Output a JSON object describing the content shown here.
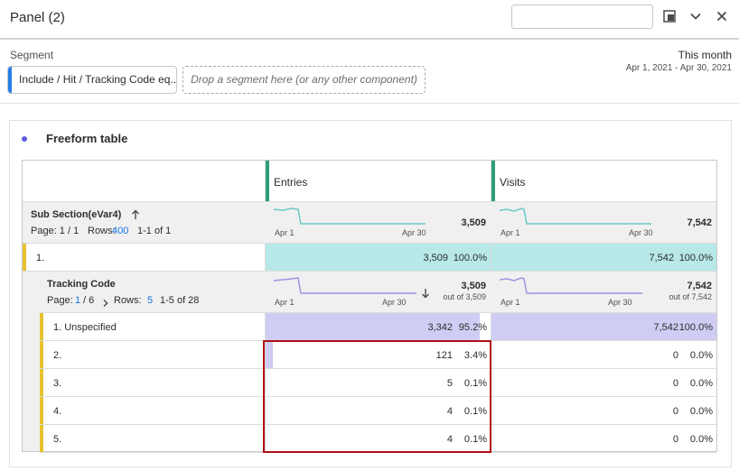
{
  "panel": {
    "title": "Panel (2)",
    "search_value": ""
  },
  "icons": {
    "collapse": "panel-toggle-icon",
    "chevron": "chevron-down-icon",
    "close": "close-icon",
    "sort": "sort-arrow-icon",
    "pager": "chevron-right-icon"
  },
  "segment": {
    "label": "Segment",
    "applied": "Include / Hit / Tracking Code eq...",
    "drop_placeholder": "Drop a segment here (or any other component)"
  },
  "date": {
    "preset": "This month",
    "range": "Apr 1, 2021 - Apr 30, 2021"
  },
  "freeform": {
    "title": "Freeform table",
    "columns": [
      {
        "label": "Entries",
        "total": "3,509",
        "spark_start": "Apr 1",
        "spark_end": "Apr 30"
      },
      {
        "label": "Visits",
        "total": "7,542",
        "spark_start": "Apr 1",
        "spark_end": "Apr 30"
      }
    ],
    "dimension": {
      "name": "Sub Section(eVar4)",
      "page_text": "Page: 1 / 1",
      "rows_label": "Rows:",
      "rows_value": "400",
      "range": "1-1 of 1"
    },
    "row1": {
      "label": "1.",
      "entries": "3,509",
      "entries_pct": "100.0%",
      "visits": "7,542",
      "visits_pct": "100.0%"
    },
    "breakdown": {
      "name": "Tracking Code",
      "page_label": "Page:",
      "page_current": "1",
      "page_total": "/ 6",
      "rows_label": "Rows:",
      "rows_value": "5",
      "range": "1-5 of 28",
      "entries_total": "3,509",
      "entries_sub": "out of 3,509",
      "visits_total": "7,542",
      "visits_sub": "out of 7,542",
      "spark_start": "Apr 1",
      "spark_end": "Apr 30"
    },
    "rows": [
      {
        "label": "1. Unspecified",
        "entries": "3,342",
        "entries_pct": "95.2%",
        "visits": "7,542",
        "visits_pct": "100.0%",
        "entries_fill": 0.952,
        "visits_fill": 1.0
      },
      {
        "label": "2.",
        "entries": "121",
        "entries_pct": "3.4%",
        "visits": "0",
        "visits_pct": "0.0%",
        "entries_fill": 0.034,
        "visits_fill": 0
      },
      {
        "label": "3.",
        "entries": "5",
        "entries_pct": "0.1%",
        "visits": "0",
        "visits_pct": "0.0%",
        "entries_fill": 0.001,
        "visits_fill": 0
      },
      {
        "label": "4.",
        "entries": "4",
        "entries_pct": "0.1%",
        "visits": "0",
        "visits_pct": "0.0%",
        "entries_fill": 0.001,
        "visits_fill": 0
      },
      {
        "label": "5.",
        "entries": "4",
        "entries_pct": "0.1%",
        "visits": "0",
        "visits_pct": "0.0%",
        "entries_fill": 0.001,
        "visits_fill": 0
      }
    ]
  },
  "colors": {
    "teal_fill": "#b8e8e8",
    "purple_fill": "#cfcdf3",
    "accent_blue": "#1473e6",
    "highlight_red": "#b10f15",
    "drag_green": "#2d9d78",
    "nesting_yellow": "#e8c22f"
  }
}
